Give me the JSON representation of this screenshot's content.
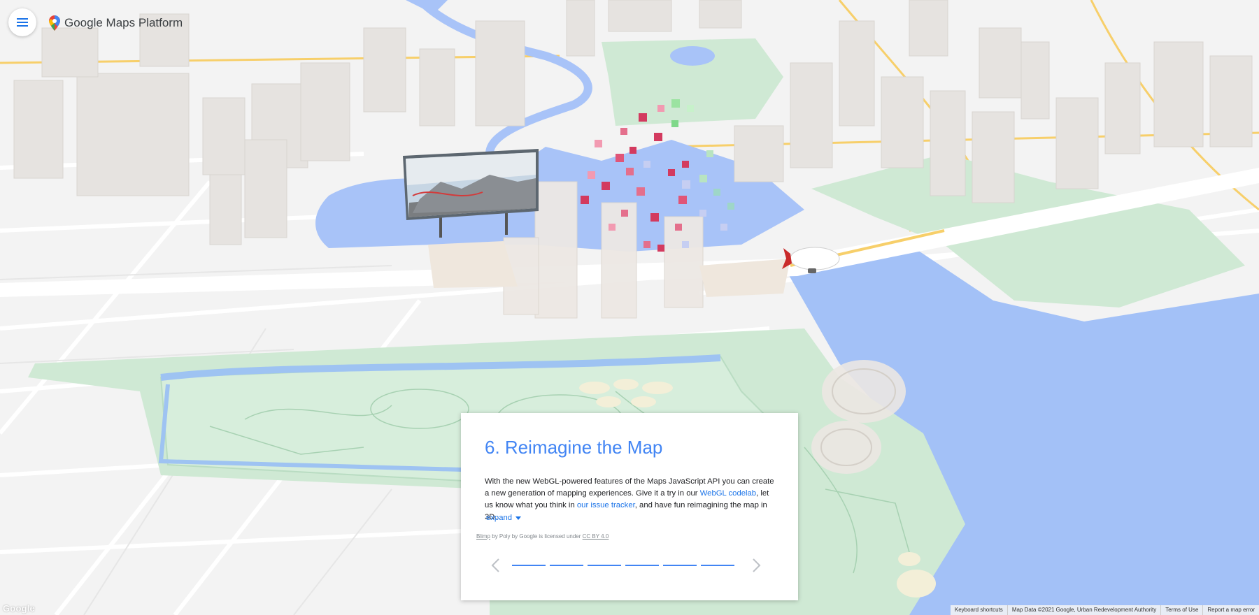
{
  "header": {
    "brand_name": "Google Maps Platform",
    "menu_icon": "hamburger-menu-icon",
    "logo_icon": "maps-pin-logo-icon"
  },
  "card": {
    "title": "6. Reimagine the Map",
    "body_1": "With the new WebGL-powered features of the Maps JavaScript API you can create a new generation of mapping experiences. Give it a try in our ",
    "link_1": "WebGL codelab",
    "body_2": ", let us know what you think in ",
    "link_2": "our issue tracker",
    "body_3": ", and have fun reimagining the map in 3D.",
    "expand_label": "expand",
    "credit": {
      "model": "Blimp",
      "text_1": " by Poly by Google is licensed under ",
      "license": "CC BY 4.0"
    },
    "pages_total": 6
  },
  "map_footer": {
    "keyboard_shortcuts": "Keyboard shortcuts",
    "map_data": "Map Data ©2021 Google, Urban Redevelopment Authority",
    "terms": "Terms of Use",
    "report": "Report a map error",
    "logo": "Google"
  },
  "colors": {
    "accent": "#4285f4",
    "link": "#1a73e8",
    "water": "#a3c1f7",
    "park": "#cfe9d4",
    "land": "#f2f2f2"
  }
}
